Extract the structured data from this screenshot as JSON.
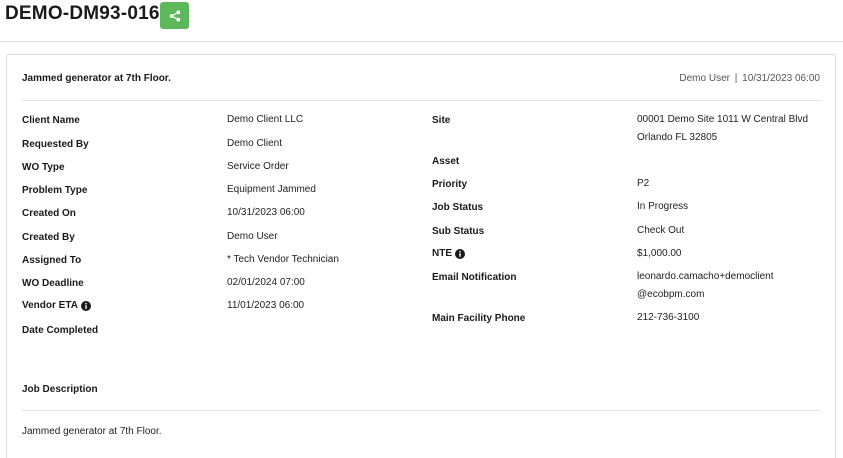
{
  "header": {
    "wo_number": "DEMO-DM93-016",
    "share_icon": "share-icon",
    "share_color": "#5cb85c"
  },
  "summary": {
    "title": "Jammed generator at 7th Floor.",
    "user": "Demo User",
    "separator": "|",
    "datetime": "10/31/2023 06:00"
  },
  "left": [
    {
      "label": "Client Name",
      "value": "Demo Client LLC"
    },
    {
      "label": "Requested By",
      "value": "Demo Client"
    },
    {
      "label": "WO Type",
      "value": "Service Order"
    },
    {
      "label": "Problem Type",
      "value": "Equipment Jammed"
    },
    {
      "label": "Created On",
      "value": "10/31/2023 06:00"
    },
    {
      "label": "Created By",
      "value": "Demo User"
    },
    {
      "label": "Assigned To",
      "value": "* Tech Vendor Technician"
    },
    {
      "label": "WO Deadline",
      "value": "02/01/2024 07:00"
    },
    {
      "label": "Vendor ETA",
      "value": "11/01/2023 06:00"
    },
    {
      "label": "Date Completed",
      "value": ""
    }
  ],
  "right": {
    "site_label": "Site",
    "site_line1": "00001 Demo Site 1011 W Central Blvd",
    "site_line2": "Orlando FL 32805",
    "asset_label": "Asset",
    "asset_value": "",
    "priority_label": "Priority",
    "priority_value": "P2",
    "job_status_label": "Job Status",
    "job_status_value": "In Progress",
    "sub_status_label": "Sub Status",
    "sub_status_value": "Check Out",
    "nte_label": "NTE",
    "nte_value": "$1,000.00",
    "email_label": "Email Notification",
    "email_line1": "leonardo.camacho+democlient",
    "email_line2": "@ecobpm.com",
    "phone_label": "Main Facility Phone",
    "phone_value": "212-736-3100"
  },
  "description": {
    "label": "Job Description",
    "text": "Jammed generator at 7th Floor."
  }
}
